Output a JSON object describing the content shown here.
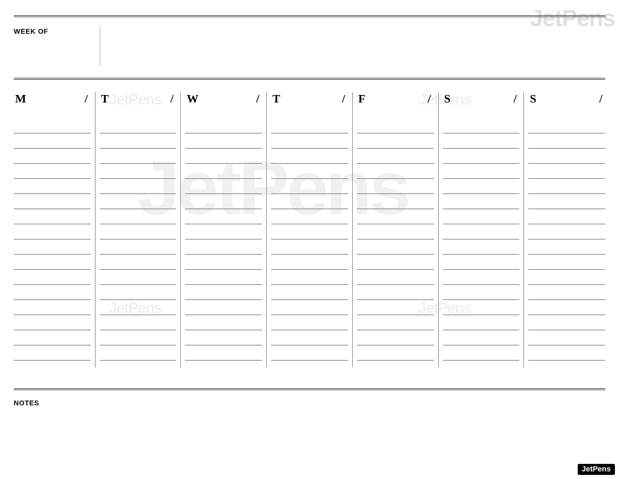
{
  "watermark": "JetPens",
  "badge": "JetPens",
  "header": {
    "week_of_label": "WEEK OF"
  },
  "days": [
    {
      "letter": "M",
      "sep": "/"
    },
    {
      "letter": "T",
      "sep": "/"
    },
    {
      "letter": "W",
      "sep": "/"
    },
    {
      "letter": "T",
      "sep": "/"
    },
    {
      "letter": "F",
      "sep": "/"
    },
    {
      "letter": "S",
      "sep": "/"
    },
    {
      "letter": "S",
      "sep": "/"
    }
  ],
  "lines_per_day": 16,
  "notes": {
    "label": "NOTES"
  }
}
